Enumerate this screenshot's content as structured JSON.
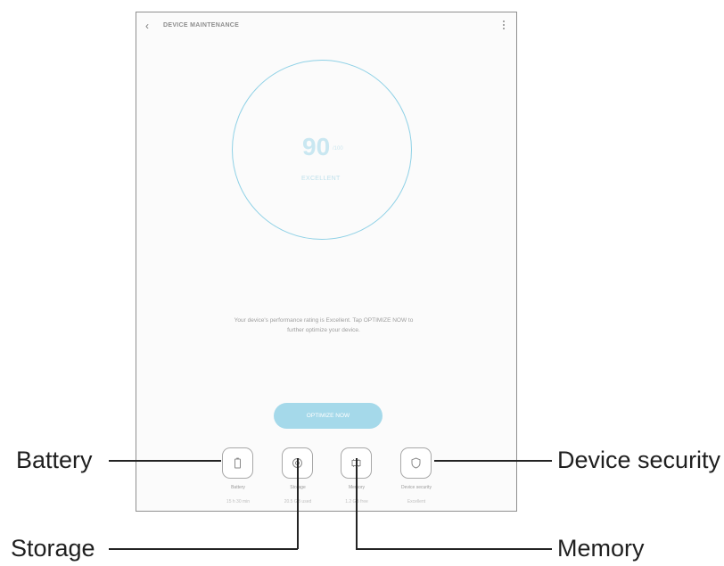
{
  "app_bar": {
    "title": "DEVICE MAINTENANCE",
    "back_icon": "chevron-left-icon",
    "menu_icon": "more-vertical-icon"
  },
  "score": {
    "value": "90",
    "unit": "/100",
    "rating": "EXCELLENT",
    "ring_color": "#8fd1e6"
  },
  "description": {
    "line1": "Your device's performance rating is Excellent. Tap OPTIMIZE NOW to",
    "line2": "further optimize your device."
  },
  "optimize_button": {
    "label": "OPTIMIZE NOW",
    "color": "#a5d9ea"
  },
  "categories": [
    {
      "label": "Battery",
      "value": "15 h 30 min",
      "icon": "battery-icon"
    },
    {
      "label": "Storage",
      "value": "20.5 GB used",
      "icon": "storage-icon"
    },
    {
      "label": "Memory",
      "value": "1.2 GB free",
      "icon": "memory-chip-icon"
    },
    {
      "label": "Device security",
      "value": "Excellent",
      "icon": "shield-icon"
    }
  ],
  "callouts": {
    "battery": "Battery",
    "storage": "Storage",
    "memory": "Memory",
    "device_security": "Device security"
  }
}
